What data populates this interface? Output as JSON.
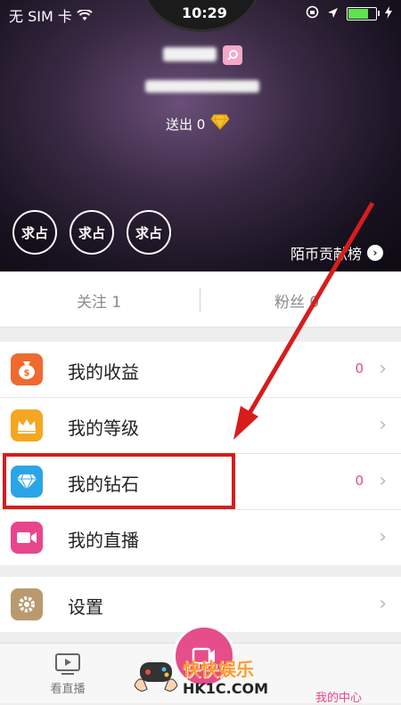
{
  "status_bar": {
    "carrier": "无 SIM 卡",
    "time": "10:29"
  },
  "profile": {
    "sent_label": "送出 0",
    "badges": [
      "求占",
      "求占",
      "求占"
    ],
    "rank_link": "陌币贡献榜"
  },
  "follow": {
    "following": "关注 1",
    "fans": "粉丝 0"
  },
  "menu": {
    "income": {
      "label": "我的收益",
      "count": "0"
    },
    "level": {
      "label": "我的等级"
    },
    "diamond": {
      "label": "我的钻石",
      "count": "0"
    },
    "live": {
      "label": "我的直播"
    },
    "settings": {
      "label": "设置"
    }
  },
  "tabbar": {
    "watch_live": "看直播",
    "my_center": "我的中心"
  },
  "watermark": {
    "text": "快快娱乐",
    "url": "HK1C.COM"
  },
  "colors": {
    "accent": "#e8468c",
    "highlight": "#d81c1c"
  }
}
